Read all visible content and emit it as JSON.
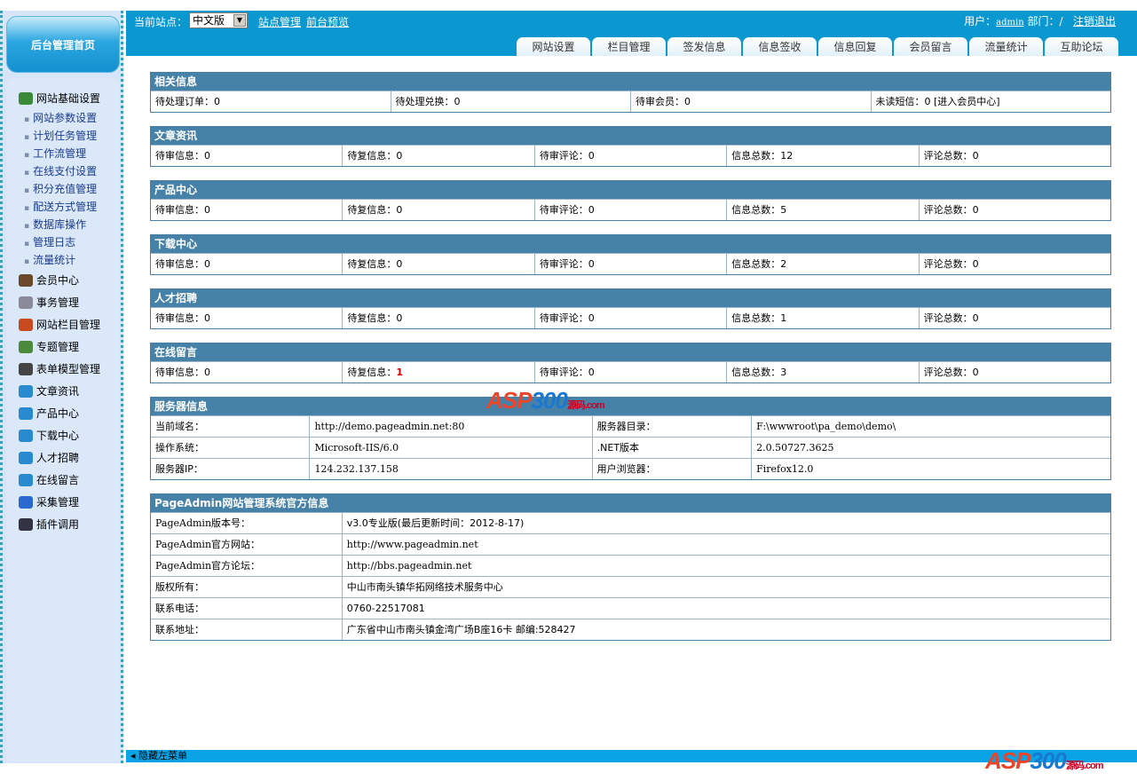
{
  "sidebar": {
    "home": "后台管理首页",
    "group1": "网站基础设置",
    "subs": [
      "网站参数设置",
      "计划任务管理",
      "工作流管理",
      "在线支付设置",
      "积分充值管理",
      "配送方式管理",
      "数据库操作",
      "管理日志",
      "流量统计"
    ],
    "groups": [
      {
        "label": "会员中心",
        "color": "#6a4a2a"
      },
      {
        "label": "事务管理",
        "color": "#8a8a9a"
      },
      {
        "label": "网站栏目管理",
        "color": "#c84a20"
      },
      {
        "label": "专题管理",
        "color": "#4a8a3a"
      },
      {
        "label": "表单模型管理",
        "color": "#444"
      },
      {
        "label": "文章资讯",
        "color": "#2a8ad0"
      },
      {
        "label": "产品中心",
        "color": "#2a8ad0"
      },
      {
        "label": "下载中心",
        "color": "#2a8ad0"
      },
      {
        "label": "人才招聘",
        "color": "#2a8ad0"
      },
      {
        "label": "在线留言",
        "color": "#2a8ad0"
      },
      {
        "label": "采集管理",
        "color": "#2a6ad0"
      },
      {
        "label": "插件调用",
        "color": "#334"
      }
    ]
  },
  "header": {
    "site_label": "当前站点：",
    "site_value": "中文版",
    "site_manage": "站点管理",
    "preview": "前台预览",
    "user_label": "用户：",
    "user": "admin",
    "dept": "部门：/",
    "logout": "注销退出",
    "tabs": [
      "网站设置",
      "栏目管理",
      "签发信息",
      "信息签收",
      "信息回复",
      "会员留言",
      "流量统计",
      "互助论坛"
    ]
  },
  "related": {
    "title": "相关信息",
    "cells": [
      "待处理订单：0",
      "待处理兑换：0",
      "待审会员：0",
      "未读短信：0 [进入会员中心]"
    ]
  },
  "stats": [
    {
      "title": "文章资讯",
      "cells": [
        "待审信息：0",
        "待复信息：0",
        "待审评论：0",
        "信息总数：12",
        "评论总数：0"
      ]
    },
    {
      "title": "产品中心",
      "cells": [
        "待审信息：0",
        "待复信息：0",
        "待审评论：0",
        "信息总数：5",
        "评论总数：0"
      ]
    },
    {
      "title": "下载中心",
      "cells": [
        "待审信息：0",
        "待复信息：0",
        "待审评论：0",
        "信息总数：2",
        "评论总数：0"
      ]
    },
    {
      "title": "人才招聘",
      "cells": [
        "待审信息：0",
        "待复信息：0",
        "待审评论：0",
        "信息总数：1",
        "评论总数：0"
      ]
    },
    {
      "title": "在线留言",
      "cells": [
        "待审信息：0",
        "待复信息：",
        "待审评论：0",
        "信息总数：3",
        "评论总数：0"
      ],
      "highlight": "1"
    }
  ],
  "server": {
    "title": "服务器信息",
    "rows": [
      [
        "当前域名：",
        "http://demo.pageadmin.net:80",
        "服务器目录：",
        "F:\\wwwroot\\pa_demo\\demo\\"
      ],
      [
        "操作系统：",
        "Microsoft-IIS/6.0",
        ".NET版本",
        "2.0.50727.3625"
      ],
      [
        "服务器IP：",
        "124.232.137.158",
        "用户浏览器：",
        "Firefox12.0"
      ]
    ]
  },
  "official": {
    "title": "PageAdmin网站管理系统官方信息",
    "rows": [
      [
        "PageAdmin版本号：",
        "v3.0专业版(最后更新时间：2012-8-17)"
      ],
      [
        "PageAdmin官方网站：",
        "http://www.pageadmin.net"
      ],
      [
        "PageAdmin官方论坛：",
        "http://bbs.pageadmin.net"
      ],
      [
        "版权所有：",
        "中山市南头镇华拓网络技术服务中心"
      ],
      [
        "联系电话：",
        "0760-22517081"
      ],
      [
        "联系地址：",
        "广东省中山市南头镇金湾广场B座16卡 邮编:528427"
      ]
    ]
  },
  "footer": {
    "hide_menu": "隐藏左菜单"
  },
  "watermark": {
    "a": "ASP",
    "b": "300",
    "c": "源码.com"
  }
}
